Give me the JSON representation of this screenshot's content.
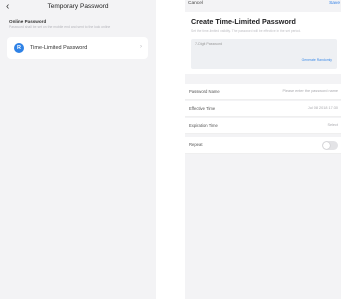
{
  "left": {
    "nav": {
      "back_icon": "chevron-left-icon",
      "title": "Temporary Password"
    },
    "section_title": "Online Password",
    "section_desc": "Password shall be set on the mobile end and sent to the lock online",
    "item": {
      "icon_letter": "R",
      "label": "Time-Limited Password"
    }
  },
  "right": {
    "cancel_label": "Cancel",
    "save_label": "Save",
    "title": "Create Time-Limited Password",
    "desc": "Set the time-limited validity. The password will be effective in the set period.",
    "pwd_label": "7-Digit Password",
    "regen_label": "Generate Randomly",
    "rows": [
      {
        "label": "Password Name",
        "value": "Please enter the password name"
      },
      {
        "label": "Effective Time",
        "value": "Jul 08 2018 17:30"
      },
      {
        "label": "Expiration Time",
        "value": "Select"
      },
      {
        "label": "Repeat",
        "value": ""
      }
    ],
    "repeat_on": false
  },
  "colors": {
    "accent": "#2f82e6",
    "background": "#f3f3f5"
  }
}
